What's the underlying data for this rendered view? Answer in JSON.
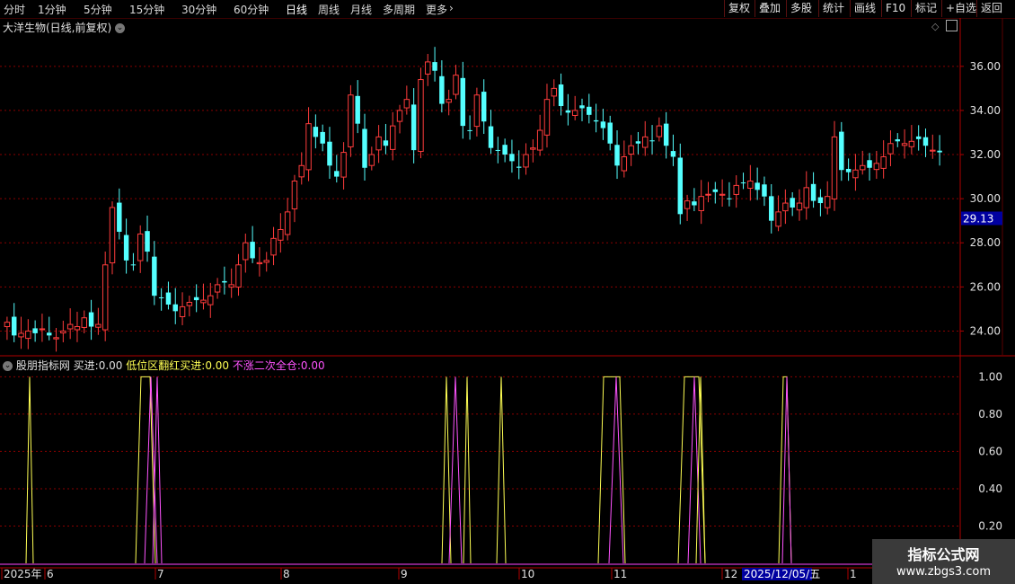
{
  "toolbar": {
    "periods": [
      "分时",
      "1分钟",
      "5分钟",
      "15分钟",
      "30分钟",
      "60分钟",
      "日线",
      "周线",
      "月线",
      "多周期",
      "更多"
    ],
    "active_period": "日线",
    "actions": [
      "复权",
      "叠加",
      "多股",
      "统计",
      "画线",
      "F10",
      "标记",
      "+自选",
      "返回"
    ]
  },
  "stock": {
    "title": "大洋生物(日线,前复权)",
    "last_price_tag": "29.13"
  },
  "price_axis": {
    "labels": [
      "36.00",
      "34.00",
      "32.00",
      "30.00",
      "28.00",
      "26.00",
      "24.00"
    ],
    "values": [
      36,
      34,
      32,
      30,
      28,
      26,
      24
    ]
  },
  "indicator": {
    "name": "股朋指标网",
    "lines": [
      {
        "label": "买进:",
        "value": "0.00",
        "color": "#e0e0e0"
      },
      {
        "label": "低位区翻红买进:",
        "value": "0.00",
        "color": "#ffff54"
      },
      {
        "label": "不涨二次全仓:",
        "value": "0.00",
        "color": "#ff54ff"
      }
    ],
    "axis_labels": [
      "1.00",
      "0.80",
      "0.60",
      "0.40",
      "0.20"
    ],
    "axis_values": [
      1.0,
      0.8,
      0.6,
      0.4,
      0.2
    ]
  },
  "date_axis": {
    "labels": [
      "2025年",
      "6",
      "7",
      "8",
      "9",
      "10",
      "11",
      "12",
      "1"
    ],
    "selected_date": "2025/12/05/五"
  },
  "watermark": {
    "line1": "指标公式网",
    "line2": "www.zbgs3.com"
  },
  "colors": {
    "up": "#ff3c3c",
    "down": "#54ffff",
    "grid": "#8a0000",
    "axis_text": "#e0e0e0"
  },
  "chart_data": [
    {
      "type": "candlestick",
      "title": "大洋生物(日线,前复权)",
      "ylim": [
        23.0,
        37.5
      ],
      "ohlc_close": [
        24.4,
        23.8,
        23.9,
        24.0,
        23.9,
        24.1,
        23.8,
        23.7,
        24.0,
        24.3,
        24.2,
        24.6,
        24.2,
        24.3,
        27.0,
        29.6,
        28.5,
        27.2,
        27.0,
        28.4,
        27.6,
        25.6,
        25.5,
        25.2,
        24.9,
        25.1,
        25.3,
        25.4,
        25.4,
        25.6,
        26.1,
        26.2,
        26.1,
        27.0,
        28.0,
        27.3,
        27.1,
        27.2,
        28.2,
        28.6,
        29.4,
        30.8,
        31.5,
        33.4,
        32.8,
        32.5,
        31.5,
        31.0,
        32.1,
        34.7,
        33.4,
        31.4,
        32.0,
        32.8,
        32.4,
        33.3,
        34.0,
        34.5,
        32.2,
        35.4,
        36.2,
        35.8,
        34.3,
        34.5,
        35.6,
        33.3,
        33.1,
        34.7,
        33.5,
        32.3,
        32.2,
        32.0,
        31.7,
        31.4,
        32.0,
        32.3,
        33.1,
        34.5,
        35.0,
        34.2,
        33.9,
        34.0,
        34.1,
        33.8,
        33.5,
        33.2,
        32.5,
        31.5,
        31.9,
        32.4,
        32.5,
        32.8,
        32.6,
        33.3,
        32.4,
        31.9,
        29.3,
        29.9,
        29.7,
        30.1,
        30.2,
        30.3,
        30.2,
        30.0,
        30.6,
        30.7,
        30.8,
        30.4,
        30.1,
        29.0,
        29.4,
        29.8,
        29.6,
        29.8,
        30.5,
        29.9,
        29.8,
        30.1,
        32.8,
        31.3,
        31.2,
        31.3,
        31.5,
        31.4,
        31.6,
        31.9,
        32.5,
        32.6,
        32.5,
        32.6,
        32.7,
        32.4,
        32.2,
        32.1
      ]
    },
    {
      "type": "line",
      "title": "股朋指标网",
      "ylim": [
        0,
        1.05
      ],
      "series": [
        {
          "name": "买进",
          "values": []
        },
        {
          "name": "低位区翻红买进",
          "values": []
        },
        {
          "name": "不涨二次全仓",
          "values": []
        }
      ]
    }
  ]
}
